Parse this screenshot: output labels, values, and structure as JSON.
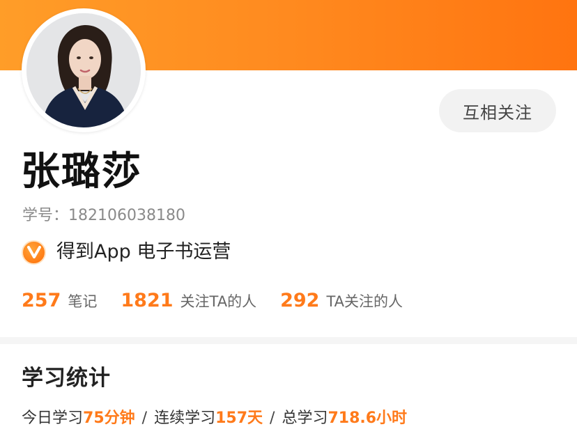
{
  "profile": {
    "name": "张璐莎",
    "student_id_label": "学号：",
    "student_id": "182106038180",
    "verification": "得到App 电子书运营",
    "follow_button": "互相关注"
  },
  "stats": [
    {
      "value": "257",
      "label": "笔记"
    },
    {
      "value": "1821",
      "label": "关注TA的人"
    },
    {
      "value": "292",
      "label": "TA关注的人"
    }
  ],
  "study_stats": {
    "title": "学习统计",
    "today_label": "今日学习",
    "today_value": "75分钟",
    "streak_label": "连续学习",
    "streak_value": "157天",
    "total_label": "总学习",
    "total_value": "718.6小时",
    "separator": "/"
  },
  "icons": {
    "verified": "verified-v-icon"
  },
  "colors": {
    "accent": "#ff7a1a",
    "banner_start": "#ff9d28",
    "banner_end": "#ff7410"
  }
}
